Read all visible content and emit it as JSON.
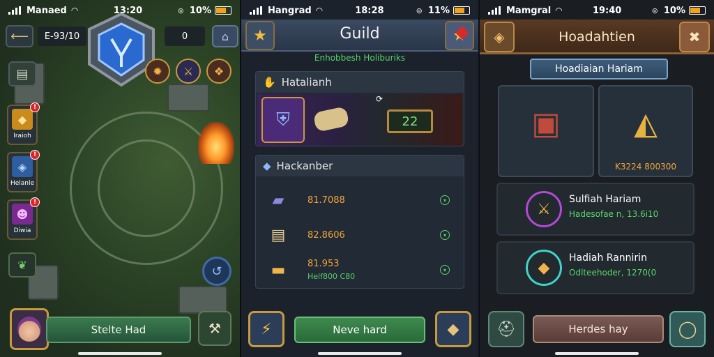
{
  "status_bars": [
    {
      "carrier": "Manaed",
      "time": "13:20",
      "battery": "10%"
    },
    {
      "carrier": "Hangrad",
      "time": "18:28",
      "battery": "11%"
    },
    {
      "carrier": "Mamgral",
      "time": "19:40",
      "battery": "10%"
    }
  ],
  "screen1": {
    "resource_value": "E-93/10",
    "count_value": "0",
    "side_buttons": [
      {
        "label": "Iraioh",
        "icon": "gem-chest-icon",
        "badge": "!"
      },
      {
        "label": "Helanle",
        "icon": "blue-cube-icon",
        "badge": "!"
      },
      {
        "label": "Diwia",
        "icon": "purple-hero-icon",
        "badge": "!"
      }
    ],
    "main_button": "Stelte Had",
    "colors": {
      "accent": "#c89a3c",
      "button": "#3b7a4e"
    }
  },
  "screen2": {
    "title": "Guild",
    "subtitle": "Enhobbesh Holiburiks",
    "section1_title": "Hatalianh",
    "level_value": "22",
    "section2_title": "Hackanber",
    "rows": [
      {
        "value": "81.7088",
        "sub": "",
        "icon": "purple-ingot-icon"
      },
      {
        "value": "82.8606",
        "sub": "",
        "icon": "parchment-icon"
      },
      {
        "value": "81.953",
        "sub": "Helf800 C80",
        "icon": "gold-bar-icon"
      }
    ],
    "main_button": "Neve hard",
    "colors": {
      "accent": "#f2be3f",
      "sub_text": "#58d06b"
    }
  },
  "screen3": {
    "title": "Hoadahtien",
    "tab_label": "Hoadiaian Hariam",
    "card_price": "K3224 800300",
    "rewards": [
      {
        "title": "Sulfiah Hariam",
        "sub": "Hadesofae n, 13.6i10",
        "ring_color": "#b14ad6"
      },
      {
        "title": "Hadiah Rannirin",
        "sub": "Odlteehoder, 1270(0",
        "ring_color": "#3fd4c8"
      }
    ],
    "main_button": "Herdes hay",
    "colors": {
      "accent": "#b88a46",
      "sub_text": "#5ad66a"
    }
  }
}
